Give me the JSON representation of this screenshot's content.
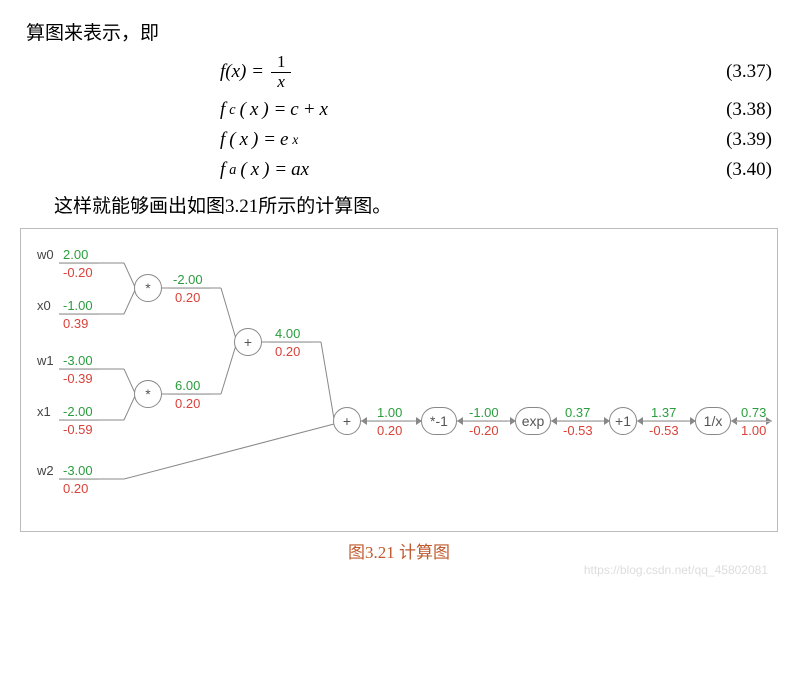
{
  "intro": "算图来表示，即",
  "equations": [
    {
      "lhs": "f(x)",
      "op": "=",
      "rhs_type": "frac",
      "rhs": "1/x",
      "num": "3.37"
    },
    {
      "lhs": "f_c(x)",
      "op": "=",
      "rhs_type": "text",
      "rhs": "c + x",
      "num": "3.38"
    },
    {
      "lhs": "f(x)",
      "op": "=",
      "rhs_type": "exp",
      "rhs": "e^x",
      "num": "3.39"
    },
    {
      "lhs": "f_a(x)",
      "op": "=",
      "rhs_type": "text",
      "rhs": "ax",
      "num": "3.40"
    }
  ],
  "mid_text": "这样就能够画出如图3.21所示的计算图。",
  "caption": "图3.21 计算图",
  "watermark": "https://blog.csdn.net/qq_45802081",
  "graph": {
    "inputs": [
      {
        "name": "w0",
        "fwd": "2.00",
        "bwd": "-0.20"
      },
      {
        "name": "x0",
        "fwd": "-1.00",
        "bwd": "0.39"
      },
      {
        "name": "w1",
        "fwd": "-3.00",
        "bwd": "-0.39"
      },
      {
        "name": "x1",
        "fwd": "-2.00",
        "bwd": "-0.59"
      },
      {
        "name": "w2",
        "fwd": "-3.00",
        "bwd": "0.20"
      }
    ],
    "nodes": [
      {
        "id": "m1",
        "label": "*",
        "out_fwd": "-2.00",
        "out_bwd": "0.20"
      },
      {
        "id": "m2",
        "label": "*",
        "out_fwd": "6.00",
        "out_bwd": "0.20"
      },
      {
        "id": "p1",
        "label": "+",
        "out_fwd": "4.00",
        "out_bwd": "0.20"
      },
      {
        "id": "p2",
        "label": "+",
        "out_fwd": "1.00",
        "out_bwd": "0.20"
      },
      {
        "id": "n1",
        "label": "*-1",
        "out_fwd": "-1.00",
        "out_bwd": "-0.20"
      },
      {
        "id": "ex",
        "label": "exp",
        "out_fwd": "0.37",
        "out_bwd": "-0.53"
      },
      {
        "id": "p3",
        "label": "+1",
        "out_fwd": "1.37",
        "out_bwd": "-0.53"
      },
      {
        "id": "iv",
        "label": "1/x",
        "out_fwd": "0.73",
        "out_bwd": "1.00"
      }
    ]
  },
  "chart_data": {
    "type": "diagram",
    "title": "图3.21 计算图",
    "description": "Computational graph (forward/backward) for sigmoid-like expression 1/(1+exp(-(w0*x0 + w1*x1 + w2)))",
    "inputs": [
      {
        "name": "w0",
        "value": 2.0,
        "grad": -0.2
      },
      {
        "name": "x0",
        "value": -1.0,
        "grad": 0.39
      },
      {
        "name": "w1",
        "value": -3.0,
        "grad": -0.39
      },
      {
        "name": "x1",
        "value": -2.0,
        "grad": -0.59
      },
      {
        "name": "w2",
        "value": -3.0,
        "grad": 0.2
      }
    ],
    "operations": [
      {
        "op": "*",
        "inputs": [
          "w0",
          "x0"
        ],
        "output": -2.0,
        "grad": 0.2,
        "id": "m1"
      },
      {
        "op": "*",
        "inputs": [
          "w1",
          "x1"
        ],
        "output": 6.0,
        "grad": 0.2,
        "id": "m2"
      },
      {
        "op": "+",
        "inputs": [
          "m1",
          "m2"
        ],
        "output": 4.0,
        "grad": 0.2,
        "id": "p1"
      },
      {
        "op": "+",
        "inputs": [
          "p1",
          "w2"
        ],
        "output": 1.0,
        "grad": 0.2,
        "id": "p2"
      },
      {
        "op": "*-1",
        "inputs": [
          "p2"
        ],
        "output": -1.0,
        "grad": -0.2,
        "id": "n1"
      },
      {
        "op": "exp",
        "inputs": [
          "n1"
        ],
        "output": 0.37,
        "grad": -0.53,
        "id": "ex"
      },
      {
        "op": "+1",
        "inputs": [
          "ex"
        ],
        "output": 1.37,
        "grad": -0.53,
        "id": "p3"
      },
      {
        "op": "1/x",
        "inputs": [
          "p3"
        ],
        "output": 0.73,
        "grad": 1.0,
        "id": "iv"
      }
    ],
    "equations": [
      {
        "label": "3.37",
        "expr": "f(x) = 1/x"
      },
      {
        "label": "3.38",
        "expr": "f_c(x) = c + x"
      },
      {
        "label": "3.39",
        "expr": "f(x) = e^x"
      },
      {
        "label": "3.40",
        "expr": "f_a(x) = ax"
      }
    ]
  }
}
